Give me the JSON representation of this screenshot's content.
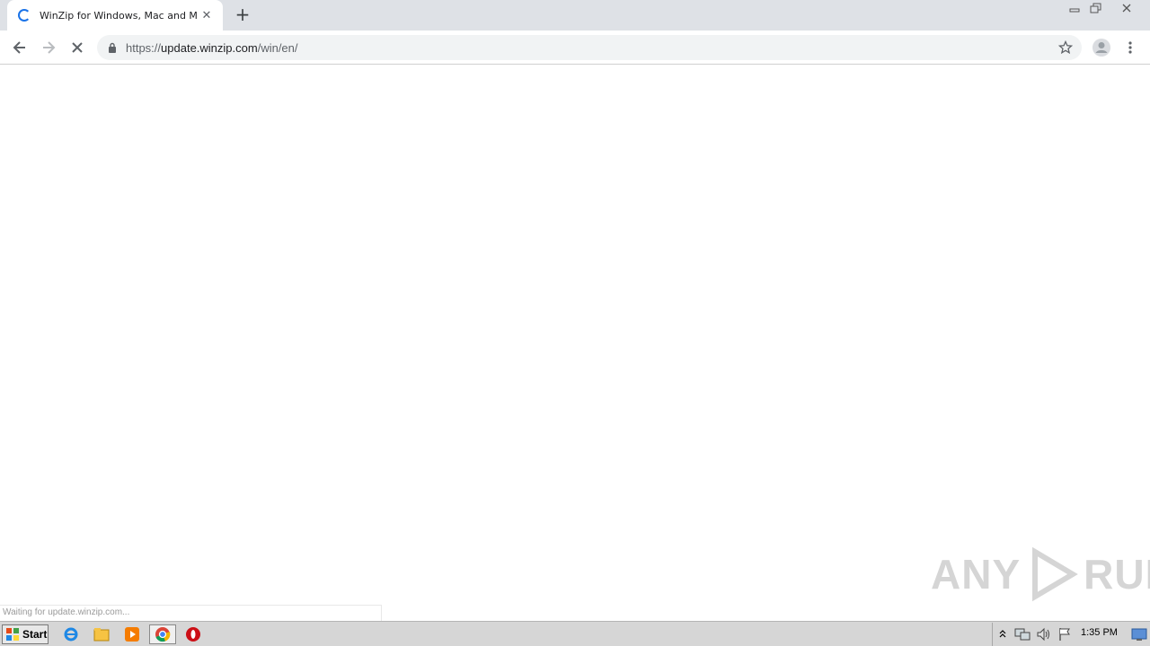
{
  "browser": {
    "tab": {
      "title": "WinZip for Windows, Mac and Mobile",
      "close_glyph": "✕"
    },
    "new_tab_glyph": "+",
    "address": {
      "scheme": "https://",
      "host": "update.winzip.com",
      "path": "/win/en/"
    },
    "status_text": "Waiting for update.winzip.com..."
  },
  "watermark": {
    "left": "ANY",
    "right": "RUN"
  },
  "taskbar": {
    "start_label": "Start",
    "clock": "1:35 PM"
  },
  "colors": {
    "accent": "#1a73e8",
    "tabstrip": "#dee1e6",
    "taskbar": "#d6d6d6"
  }
}
